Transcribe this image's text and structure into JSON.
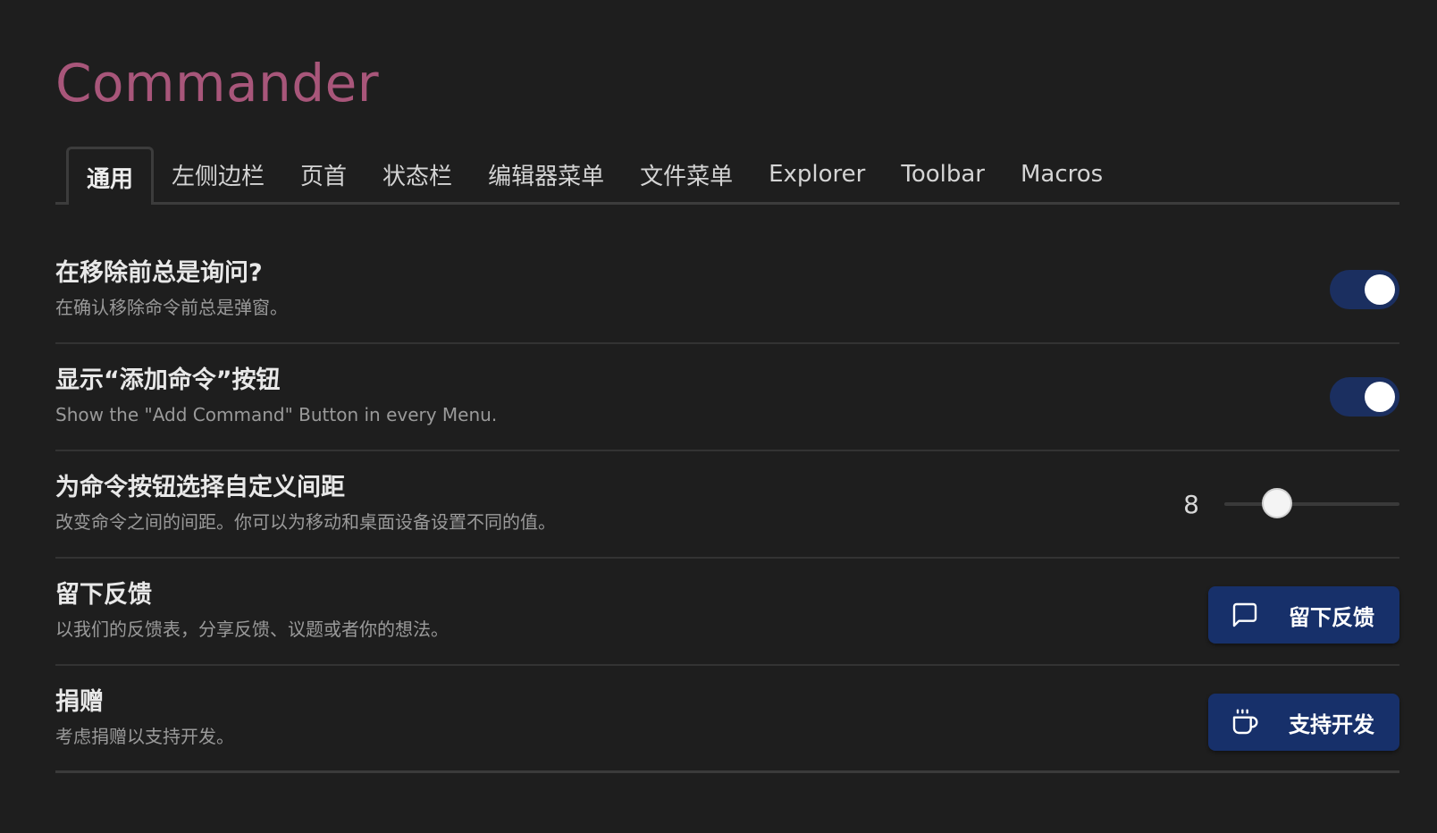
{
  "title": "Commander",
  "tabs": [
    {
      "label": "通用"
    },
    {
      "label": "左侧边栏"
    },
    {
      "label": "页首"
    },
    {
      "label": "状态栏"
    },
    {
      "label": "编辑器菜单"
    },
    {
      "label": "文件菜单"
    },
    {
      "label": "Explorer"
    },
    {
      "label": "Toolbar"
    },
    {
      "label": "Macros"
    }
  ],
  "active_tab": "通用",
  "settings": {
    "confirm_remove": {
      "name": "在移除前总是询问?",
      "desc": "在确认移除命令前总是弹窗。",
      "enabled": true
    },
    "show_add_command": {
      "name": "显示“添加命令”按钮",
      "desc": "Show the \"Add Command\" Button in every Menu.",
      "enabled": true
    },
    "spacing": {
      "name": "为命令按钮选择自定义间距",
      "desc": "改变命令之间的间距。你可以为移动和桌面设备设置不同的值。",
      "value": "8",
      "fraction": 0.3
    },
    "feedback": {
      "name": "留下反馈",
      "desc": "以我们的反馈表，分享反馈、议题或者你的想法。",
      "button_label": "留下反馈",
      "icon": "message-square-icon"
    },
    "donate": {
      "name": "捐赠",
      "desc": "考虑捐赠以支持开发。",
      "button_label": "支持开发",
      "icon": "coffee-icon"
    }
  },
  "colors": {
    "background": "#1e1e1e",
    "title": "#a8567a",
    "accent": "#1b2f60",
    "button": "#17306a"
  }
}
